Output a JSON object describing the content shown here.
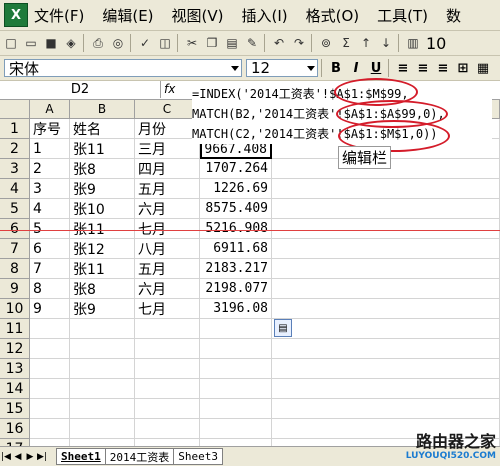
{
  "menubar": {
    "items": [
      "文件(F)",
      "编辑(E)",
      "视图(V)",
      "插入(I)",
      "格式(O)",
      "工具(T)",
      "数"
    ]
  },
  "toolbar": {
    "zoom": "10"
  },
  "format_bar": {
    "font_name": "宋体",
    "font_size": "12",
    "bold": "B",
    "italic": "I",
    "underline": "U"
  },
  "formula_bar": {
    "name_box": "D2",
    "fx": "fx",
    "lines": [
      "=INDEX('2014工资表'!$A$1:$M$99,",
      "MATCH(B2,'2014工资表'!$A$1:$A$99,0),",
      "MATCH(C2,'2014工资表'!$A$1:$M$1,0))"
    ]
  },
  "columns": [
    "A",
    "B",
    "C"
  ],
  "rows": [
    "1",
    "2",
    "3",
    "4",
    "5",
    "6",
    "7",
    "8",
    "9",
    "10",
    "11",
    "12",
    "13",
    "14",
    "15",
    "16",
    "17"
  ],
  "table": {
    "headers": [
      "序号",
      "姓名",
      "月份"
    ],
    "data": [
      [
        "1",
        "张11",
        "三月",
        "9667.408"
      ],
      [
        "2",
        "张8",
        "四月",
        "1707.264"
      ],
      [
        "3",
        "张9",
        "五月",
        "1226.69"
      ],
      [
        "4",
        "张10",
        "六月",
        "8575.409"
      ],
      [
        "5",
        "张11",
        "七月",
        "5216.908"
      ],
      [
        "6",
        "张12",
        "八月",
        "6911.68"
      ],
      [
        "7",
        "张11",
        "五月",
        "2183.217"
      ],
      [
        "8",
        "张8",
        "六月",
        "2198.077"
      ],
      [
        "9",
        "张9",
        "七月",
        "3196.08"
      ]
    ]
  },
  "annotation": {
    "edit_label": "编辑栏"
  },
  "tabs": [
    "Sheet1",
    "2014工资表",
    "Sheet3"
  ],
  "watermark": {
    "title": "路由器之家",
    "url": "LUYOUQI520.COM"
  }
}
